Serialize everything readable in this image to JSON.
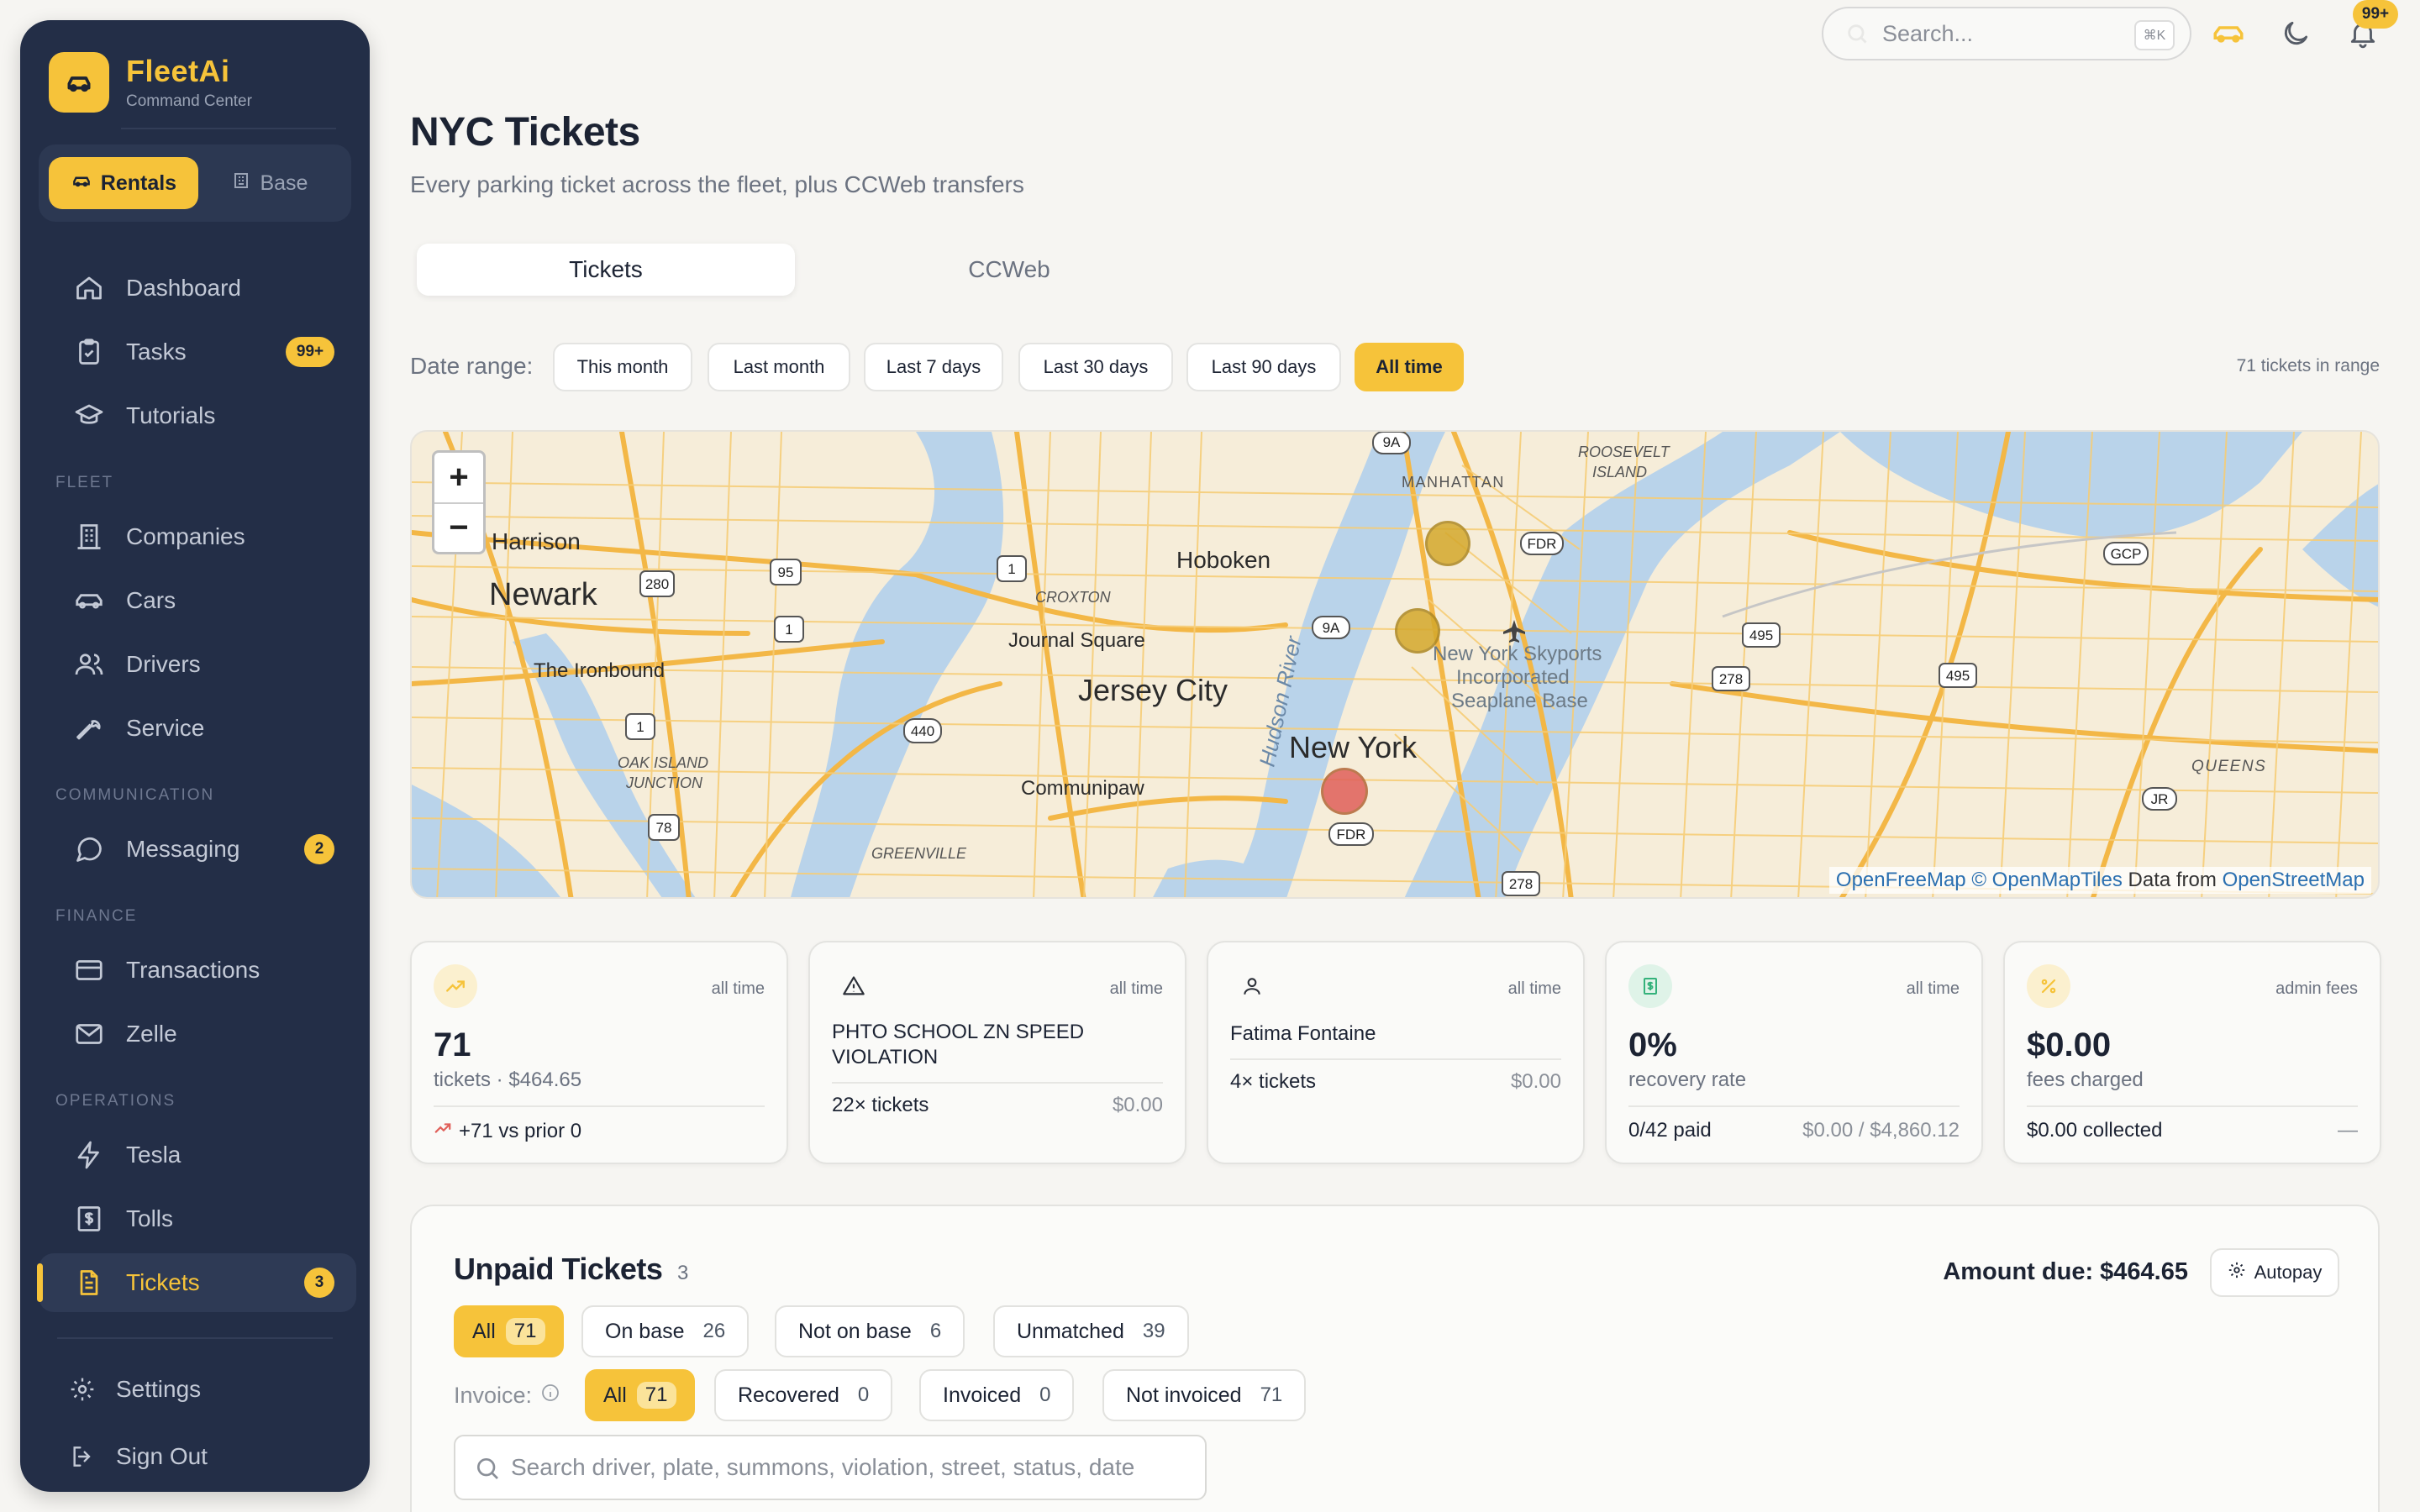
{
  "sidebar": {
    "brand_name": "FleetAi",
    "brand_sub": "Command Center",
    "mode_active": "Rentals",
    "mode_inactive": "Base",
    "items": [
      {
        "label": "Dashboard",
        "icon": "home-icon"
      },
      {
        "label": "Tasks",
        "icon": "clipboard-check-icon",
        "badge": "99+"
      },
      {
        "label": "Tutorials",
        "icon": "graduation-cap-icon"
      },
      {
        "label": "Companies",
        "icon": "building-icon"
      },
      {
        "label": "Cars",
        "icon": "car-icon"
      },
      {
        "label": "Drivers",
        "icon": "users-icon"
      },
      {
        "label": "Service",
        "icon": "wrench-icon"
      },
      {
        "label": "Messaging",
        "icon": "message-circle-icon",
        "badge": "2"
      },
      {
        "label": "Transactions",
        "icon": "credit-card-icon"
      },
      {
        "label": "Zelle",
        "icon": "mail-icon"
      },
      {
        "label": "Tesla",
        "icon": "lightning-icon"
      },
      {
        "label": "Tolls",
        "icon": "receipt-icon"
      },
      {
        "label": "Tickets",
        "icon": "file-text-icon",
        "badge": "3"
      }
    ],
    "sections": [
      "FLEET",
      "COMMUNICATION",
      "FINANCE",
      "OPERATIONS"
    ],
    "settings_label": "Settings",
    "signout_label": "Sign Out"
  },
  "topbar": {
    "search_placeholder": "Search...",
    "search_shortcut": "⌘K",
    "notif_badge": "99+"
  },
  "header": {
    "title": "NYC Tickets",
    "subtitle": "Every parking ticket across the fleet, plus CCWeb transfers"
  },
  "tabs": [
    "Tickets",
    "CCWeb"
  ],
  "date_range": {
    "label": "Date range:",
    "options": [
      "This month",
      "Last month",
      "Last 7 days",
      "Last 30 days",
      "Last 90 days",
      "All time"
    ],
    "selected": "All time",
    "count_text": "71 tickets in range"
  },
  "map": {
    "zoom_in": "+",
    "zoom_out": "−",
    "attrib_1": "OpenFreeMap",
    "attrib_2": "© OpenMapTiles",
    "attrib_3": " Data from ",
    "attrib_4": "OpenStreetMap",
    "places": {
      "newark": "Newark",
      "harrison": "Harrison",
      "ironbound": "The Ironbound",
      "oakisland_1": "OAK ISLAND",
      "oakisland_2": "JUNCTION",
      "hoboken": "Hoboken",
      "croxton": "CROXTON",
      "journal": "Journal Square",
      "jersey": "Jersey City",
      "communipaw": "Communipaw",
      "greenville": "GREENVILLE",
      "hudson": "Hudson River",
      "manhattan": "MANHATTAN",
      "newyork": "New York",
      "roosevelt_1": "ROOSEVELT",
      "roosevelt_2": "ISLAND",
      "skyports_1": "New York Skyports",
      "skyports_2": "Incorporated",
      "skyports_3": "Seaplane Base",
      "queens": "QUEENS"
    },
    "shields": {
      "r280": "280",
      "r95": "95",
      "r1a": "1",
      "r1b": "1",
      "r1c": "1",
      "r440": "440",
      "r78": "78",
      "r9a_top": "9A",
      "r9a": "9A",
      "fdr_top": "FDR",
      "fdr_bottom": "FDR",
      "r495a": "495",
      "r495b": "495",
      "r278a": "278",
      "r278b": "278",
      "gcp": "GCP",
      "jr": "JR"
    },
    "markers": [
      {
        "color": "#d4a82c"
      },
      {
        "color": "#d4a82c"
      },
      {
        "color": "#e0605a"
      }
    ]
  },
  "cards": [
    {
      "tag": "all time",
      "big": "71",
      "sub": "tickets · $464.65",
      "foot_left": "+71 vs prior 0",
      "icon": "trending-up-icon",
      "color": "#f6c33a"
    },
    {
      "tag": "all time",
      "name": "PHTO SCHOOL ZN SPEED VIOLATION",
      "foot_left": "22× tickets",
      "foot_right": "$0.00",
      "icon": "alert-triangle-icon"
    },
    {
      "tag": "all time",
      "name": "Fatima Fontaine",
      "foot_left": "4× tickets",
      "foot_right": "$0.00",
      "icon": "user-icon"
    },
    {
      "tag": "all time",
      "big": "0%",
      "sub": "recovery rate",
      "foot_left": "0/42 paid",
      "foot_right": "$0.00 / $4,860.12",
      "icon": "dollar-receipt-icon",
      "color": "#34b27b"
    },
    {
      "tag": "admin fees",
      "big": "$0.00",
      "sub": "fees charged",
      "foot_left": "$0.00 collected",
      "foot_right": "—",
      "icon": "percent-icon",
      "color": "#f6c33a"
    }
  ],
  "unpaid": {
    "title": "Unpaid Tickets",
    "count": "3",
    "amount_due": "Amount due: $464.65",
    "autopay_label": "Autopay",
    "filters": [
      {
        "label": "All",
        "count": "71"
      },
      {
        "label": "On base",
        "count": "26"
      },
      {
        "label": "Not on base",
        "count": "6"
      },
      {
        "label": "Unmatched",
        "count": "39"
      }
    ],
    "invoice_label": "Invoice:",
    "invoice_filters": [
      {
        "label": "All",
        "count": "71"
      },
      {
        "label": "Recovered",
        "count": "0"
      },
      {
        "label": "Invoiced",
        "count": "0"
      },
      {
        "label": "Not invoiced",
        "count": "71"
      }
    ],
    "search_placeholder": "Search driver, plate, summons, violation, street, status, date"
  }
}
